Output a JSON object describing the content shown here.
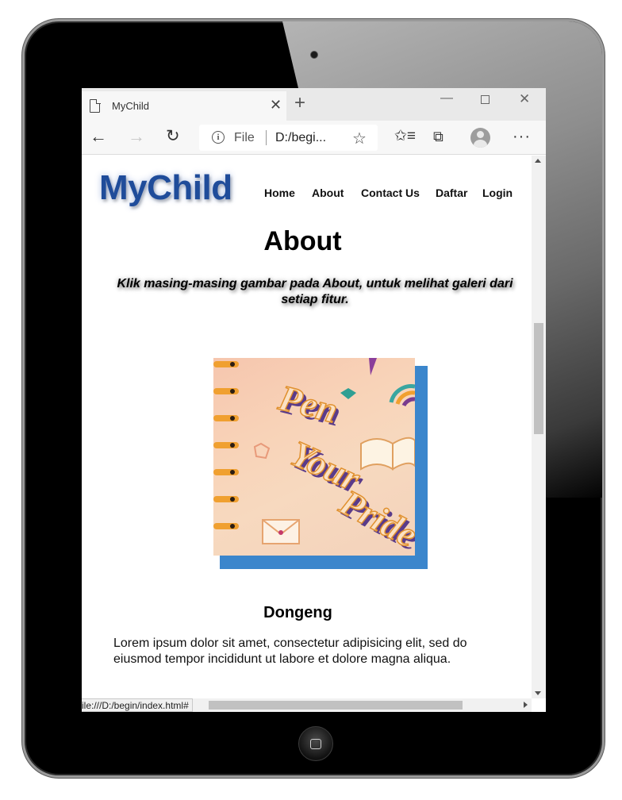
{
  "browser": {
    "tab_title": "MyChild",
    "tab_close": "✕",
    "new_tab": "+",
    "window_minimize": "—",
    "window_close": "✕",
    "address": {
      "scheme": "File",
      "url": "D:/begi..."
    },
    "status_url": "ile:///D:/begin/index.html#"
  },
  "site": {
    "logo": "MyChild",
    "nav": [
      "Home",
      "About",
      "Contact Us",
      "Daftar",
      "Login"
    ]
  },
  "page": {
    "title": "About",
    "intro": "Klik masing-masing gambar pada About, untuk melihat galeri dari setiap fitur.",
    "gallery": {
      "image_alt": "Pen Your Pride",
      "image_text": [
        "Pen",
        "Your",
        "Pride"
      ],
      "frame_color": "#3b86cc"
    },
    "section": {
      "title": "Dongeng",
      "text": "Lorem ipsum dolor sit amet, consectetur adipisicing elit, sed do eiusmod tempor incididunt ut labore et dolore magna aliqua."
    }
  },
  "colors": {
    "logo": "#1f4c9a",
    "frame_shadow": "#3b86cc"
  }
}
